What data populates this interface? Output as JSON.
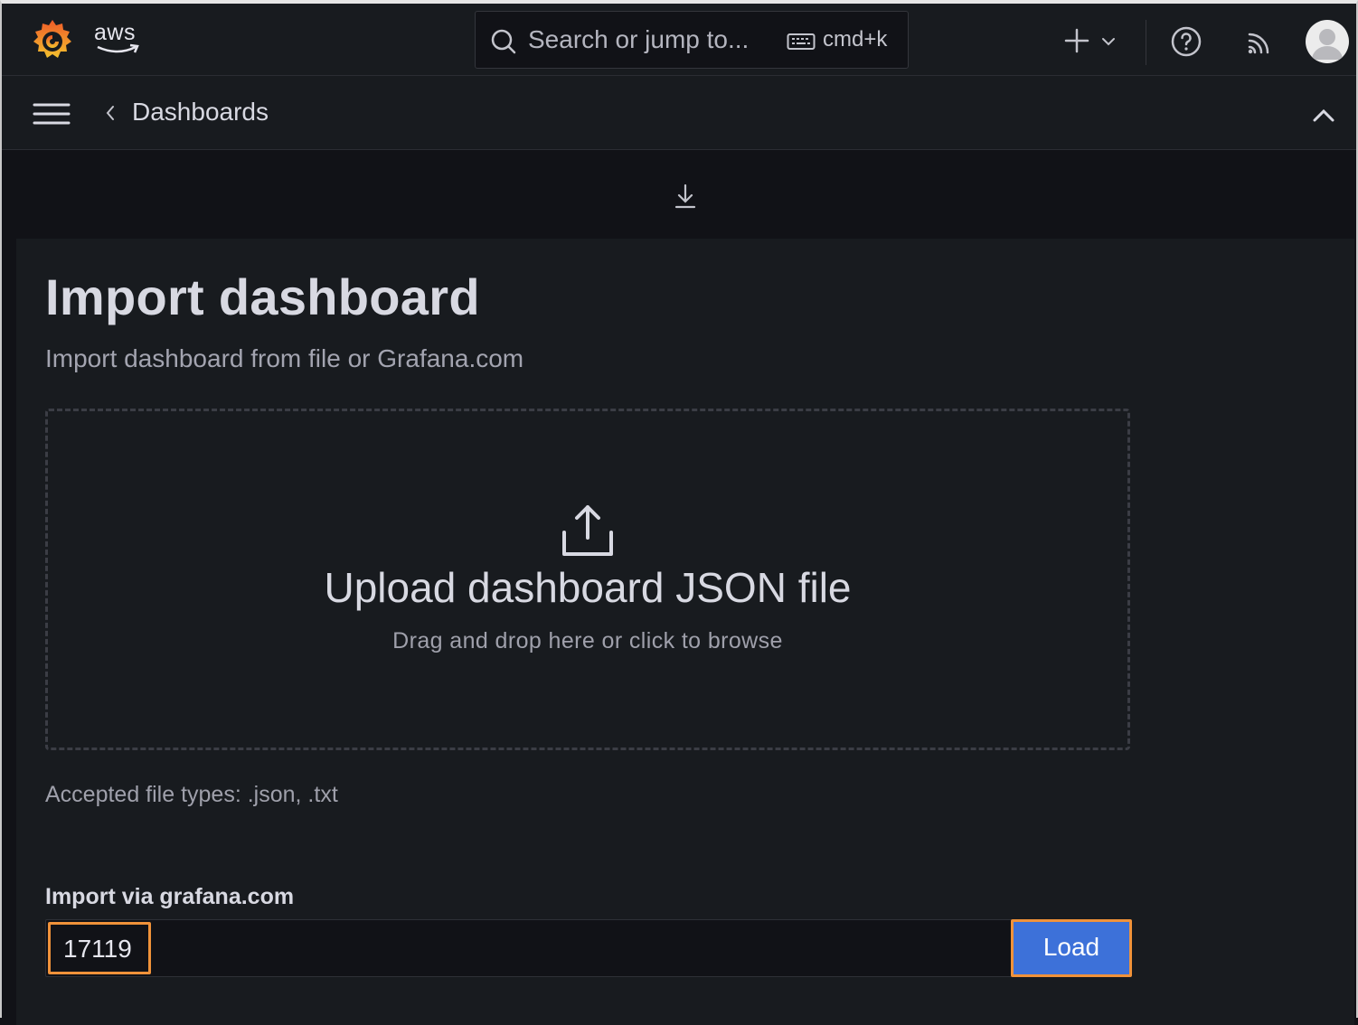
{
  "header": {
    "logo": "grafana-logo",
    "brand_text": "aws",
    "search": {
      "placeholder": "Search or jump to...",
      "shortcut": "cmd+k"
    },
    "icons": [
      "plus-icon",
      "chevron-down-icon",
      "help-icon",
      "news-icon",
      "avatar"
    ]
  },
  "breadcrumb": {
    "label": "Dashboards"
  },
  "page": {
    "title": "Import dashboard",
    "subtitle": "Import dashboard from file or Grafana.com"
  },
  "upload": {
    "title": "Upload dashboard JSON file",
    "hint": "Drag and drop here or click to browse",
    "accepted": "Accepted file types: .json, .txt"
  },
  "grafana_import": {
    "label": "Import via grafana.com",
    "value": "17119",
    "button": "Load"
  },
  "colors": {
    "accent": "#3d71d9",
    "highlight": "#f0923a",
    "background": "#181b1f"
  }
}
